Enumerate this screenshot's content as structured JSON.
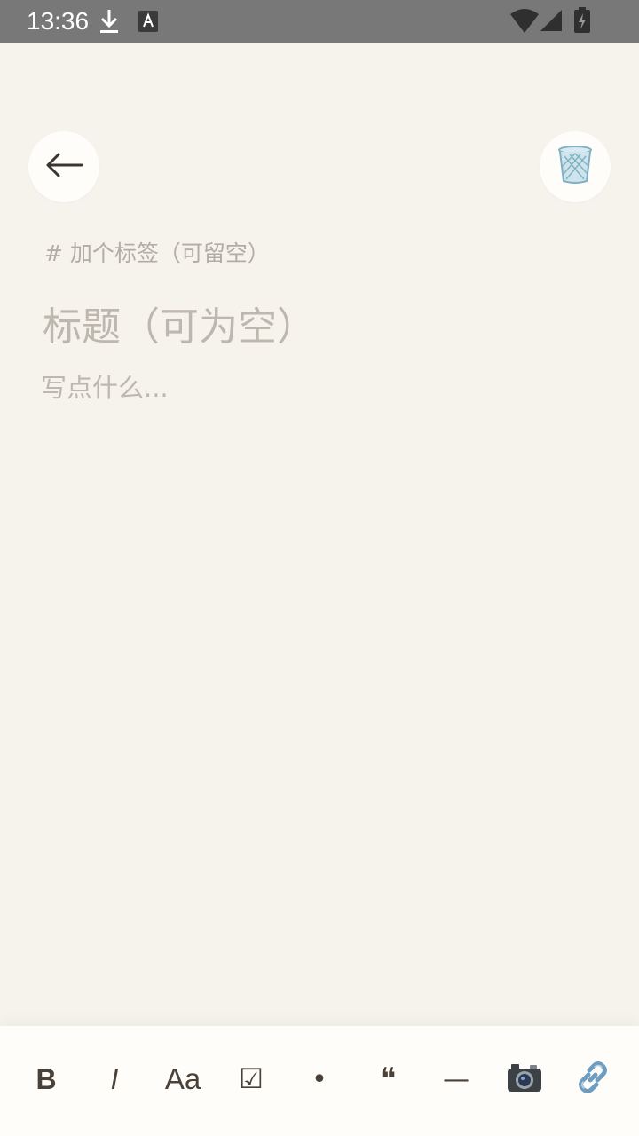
{
  "status_bar": {
    "time": "13:36",
    "icons": [
      "download-icon",
      "keyboard-a-icon",
      "wifi-icon",
      "signal-icon",
      "battery-charging-icon"
    ]
  },
  "header": {
    "back_icon": "back-arrow-icon",
    "delete_icon": "trash-icon"
  },
  "editor": {
    "tag_placeholder": "# 加个标签（可留空）",
    "title_placeholder": "标题（可为空）",
    "body_placeholder": "写点什么..."
  },
  "toolbar": {
    "bold_label": "B",
    "italic_label": "I",
    "font_size_label": "Aa",
    "checkbox_label": "☑",
    "bullet_label": "•",
    "quote_label": "❝",
    "divider_label": "—",
    "camera_icon": "camera-icon",
    "link_icon": "link-icon"
  },
  "colors": {
    "background": "#f6f2ec",
    "status_bar": "#787878",
    "button_bg": "#fffdf9",
    "placeholder": "#bdb7ae",
    "tool_icon": "#4a4239"
  }
}
